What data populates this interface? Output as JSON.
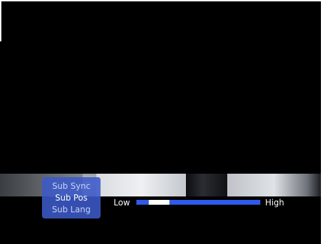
{
  "osd": {
    "menu_items": [
      {
        "label": "Sub Sync",
        "selected": false
      },
      {
        "label": "Sub Pos",
        "selected": true
      },
      {
        "label": "Sub Lang",
        "selected": false
      }
    ]
  },
  "slider": {
    "low_label": "Low",
    "high_label": "High",
    "value": 0.12
  },
  "colors": {
    "menu_bg": "#3c5ac8",
    "track": "#2f5bea",
    "thumb": "#ffffff"
  }
}
